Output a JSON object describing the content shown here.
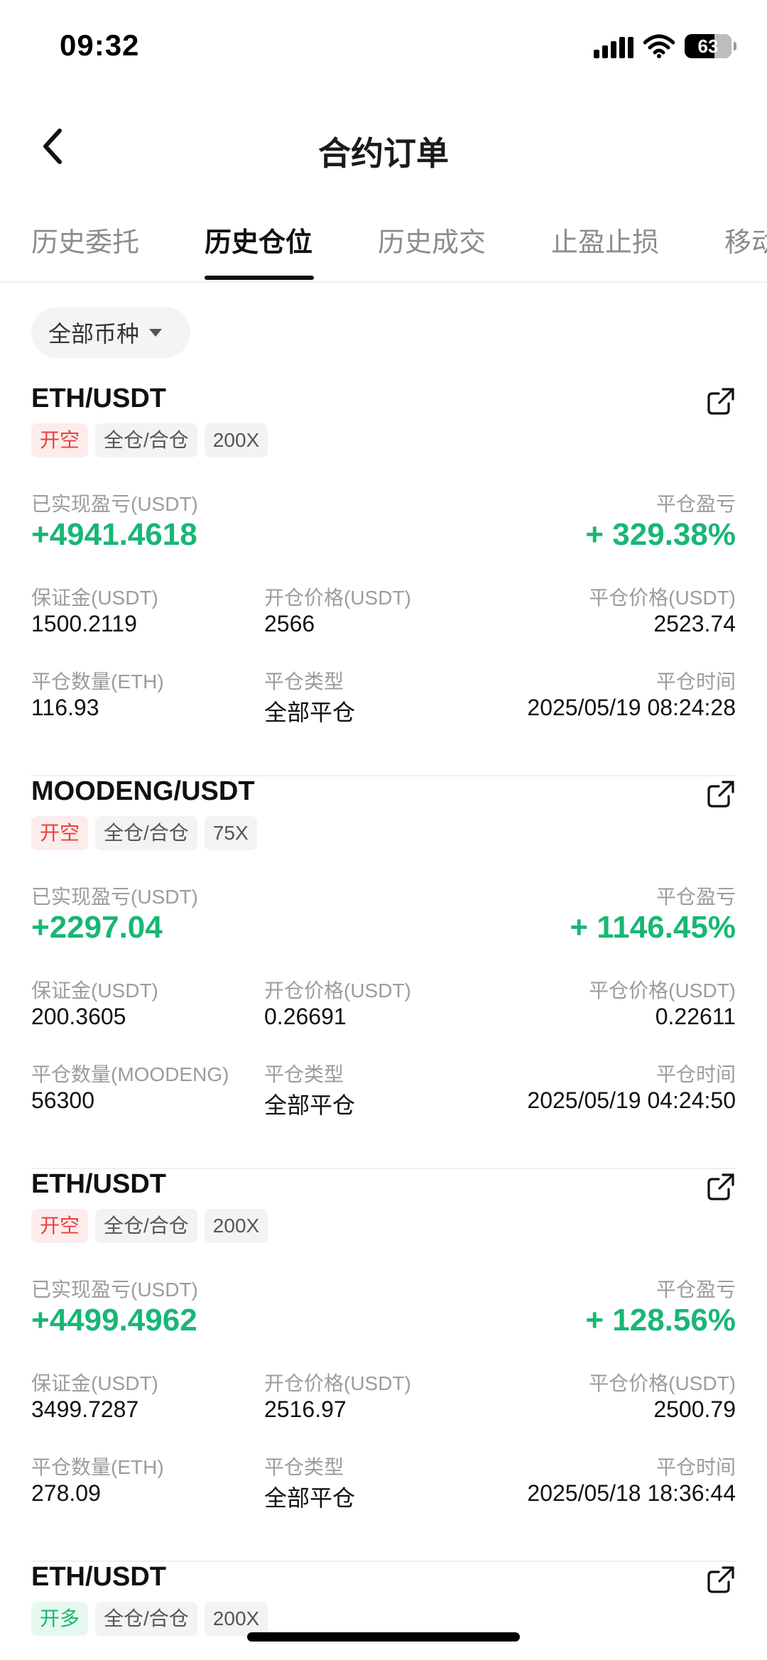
{
  "status_bar": {
    "time": "09:32",
    "battery": "63"
  },
  "header": {
    "title": "合约订单"
  },
  "tabs": [
    {
      "label": "历史委托",
      "active": false
    },
    {
      "label": "历史仓位",
      "active": true
    },
    {
      "label": "历史成交",
      "active": false
    },
    {
      "label": "止盈止损",
      "active": false
    },
    {
      "label": "移动",
      "active": false
    }
  ],
  "filter": {
    "label": "全部币种"
  },
  "labels": {
    "realized_pnl": "已实现盈亏(USDT)",
    "close_pnl": "平仓盈亏",
    "margin": "保证金(USDT)",
    "open_price": "开仓价格(USDT)",
    "close_price": "平仓价格(USDT)",
    "close_type": "平仓类型",
    "close_time": "平仓时间"
  },
  "orders": [
    {
      "pair": "ETH/USDT",
      "side": "开空",
      "mode": "全仓/合仓",
      "leverage": "200X",
      "realized_pnl": "+4941.4618",
      "close_pnl_pct": "+ 329.38%",
      "margin": "1500.2119",
      "open_price": "2566",
      "close_price": "2523.74",
      "qty_label": "平仓数量(ETH)",
      "qty": "116.93",
      "close_type": "全部平仓",
      "close_time": "2025/05/19 08:24:28"
    },
    {
      "pair": "MOODENG/USDT",
      "side": "开空",
      "mode": "全仓/合仓",
      "leverage": "75X",
      "realized_pnl": "+2297.04",
      "close_pnl_pct": "+ 1146.45%",
      "margin": "200.3605",
      "open_price": "0.26691",
      "close_price": "0.22611",
      "qty_label": "平仓数量(MOODENG)",
      "qty": "56300",
      "close_type": "全部平仓",
      "close_time": "2025/05/19 04:24:50"
    },
    {
      "pair": "ETH/USDT",
      "side": "开空",
      "mode": "全仓/合仓",
      "leverage": "200X",
      "realized_pnl": "+4499.4962",
      "close_pnl_pct": "+ 128.56%",
      "margin": "3499.7287",
      "open_price": "2516.97",
      "close_price": "2500.79",
      "qty_label": "平仓数量(ETH)",
      "qty": "278.09",
      "close_type": "全部平仓",
      "close_time": "2025/05/18 18:36:44"
    },
    {
      "pair": "ETH/USDT",
      "side": "开多",
      "mode": "全仓/合仓",
      "leverage": "200X"
    }
  ],
  "colors": {
    "profit": "#18b774",
    "short": "#e8413d",
    "long": "#14b86a"
  }
}
